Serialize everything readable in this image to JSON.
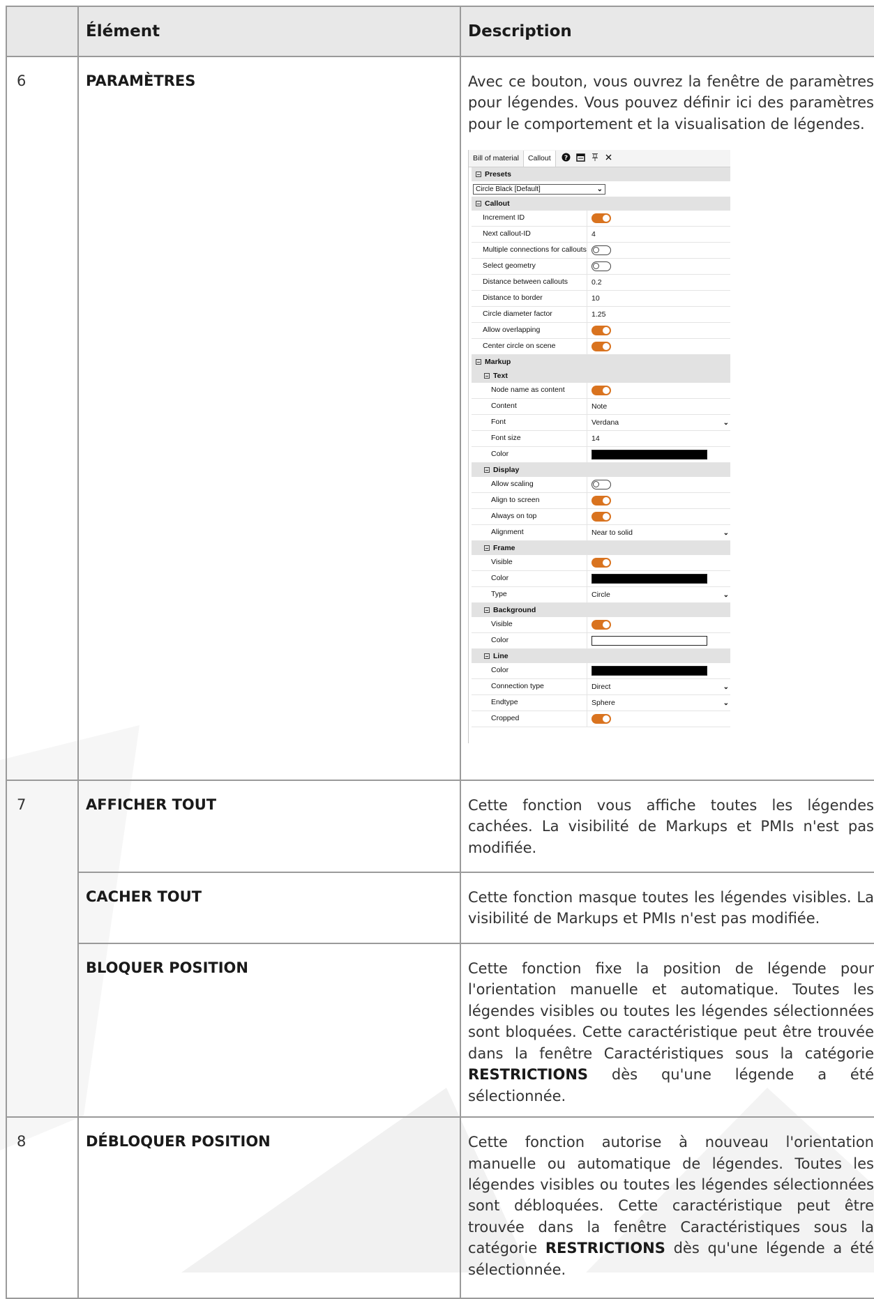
{
  "table": {
    "headers": [
      "",
      "Élément",
      "Description"
    ],
    "rows": [
      {
        "num": "6",
        "name": "PARAMÈTRES",
        "description": "Avec ce bouton, vous ouvrez la fenêtre de paramètres pour légendes. Vous pouvez définir ici des paramètres pour le comportement et la visualisation de légendes."
      },
      {
        "num": "7",
        "name": "AFFICHER TOUT",
        "description": "Cette fonction vous affiche toutes les légendes cachées. La visibilité de Markups et PMIs n'est pas modifiée."
      },
      {
        "num": "",
        "name": "CACHER TOUT",
        "description": "Cette fonction masque toutes les légendes visibles. La visibilité de Markups et PMIs n'est pas modifiée."
      },
      {
        "num": "",
        "name": "BLOQUER POSITION",
        "description_pre": "Cette fonction fixe la position de légende pour l'orientation manuelle et automatique. Toutes les légendes visibles ou toutes les légendes sélectionnées sont bloquées. Cette caractéristique peut être trouvée dans la fenêtre Caractéristiques sous la catégorie",
        "description_bold": "RESTRICTIONS",
        "description_post": "dès qu'une légende a été sélectionnée."
      },
      {
        "num": "8",
        "name": "DÉBLOQUER POSITION",
        "description_pre": "Cette fonction autorise à nouveau l'orientation manuelle ou automatique de légendes. Toutes les légendes visibles ou toutes les légendes sélectionnées sont débloquées. Cette caractéristique peut être trouvée dans la fenêtre Caractéristiques sous la catégorie",
        "description_bold": "RESTRICTIONS",
        "description_post": "dès qu'une légende a été sélectionnée."
      }
    ]
  },
  "panel": {
    "tabs": [
      "Bill of material",
      "Callout"
    ],
    "icons": [
      "help-icon",
      "window-icon",
      "pin-icon",
      "close-icon"
    ],
    "colors": {
      "toggle_on": "#d9731f",
      "group_bg": "#e2e2e2"
    },
    "presets": {
      "label": "Presets",
      "value": "Circle Black [Default]"
    },
    "callout": {
      "label": "Callout",
      "rows": [
        {
          "label": "Increment ID",
          "type": "toggle",
          "on": true
        },
        {
          "label": "Next callout-ID",
          "type": "text",
          "value": "4"
        },
        {
          "label": "Multiple connections for callouts",
          "type": "toggle",
          "on": false
        },
        {
          "label": "Select geometry",
          "type": "toggle",
          "on": false
        },
        {
          "label": "Distance between callouts",
          "type": "text",
          "value": "0.2"
        },
        {
          "label": "Distance to border",
          "type": "text",
          "value": "10"
        },
        {
          "label": "Circle diameter factor",
          "type": "text",
          "value": "1.25"
        },
        {
          "label": "Allow overlapping",
          "type": "toggle",
          "on": true
        },
        {
          "label": "Center circle on scene",
          "type": "toggle",
          "on": true
        }
      ]
    },
    "markup": {
      "label": "Markup",
      "groups": [
        {
          "label": "Text",
          "rows": [
            {
              "label": "Node name as content",
              "type": "toggle",
              "on": true
            },
            {
              "label": "Content",
              "type": "text",
              "value": "Note"
            },
            {
              "label": "Font",
              "type": "select",
              "value": "Verdana"
            },
            {
              "label": "Font size",
              "type": "text",
              "value": "14"
            },
            {
              "label": "Color",
              "type": "color",
              "color": "#000000"
            }
          ]
        },
        {
          "label": "Display",
          "rows": [
            {
              "label": "Allow scaling",
              "type": "toggle",
              "on": false
            },
            {
              "label": "Align to screen",
              "type": "toggle",
              "on": true
            },
            {
              "label": "Always on top",
              "type": "toggle",
              "on": true
            },
            {
              "label": "Alignment",
              "type": "select",
              "value": "Near to solid"
            }
          ]
        },
        {
          "label": "Frame",
          "rows": [
            {
              "label": "Visible",
              "type": "toggle",
              "on": true
            },
            {
              "label": "Color",
              "type": "color",
              "color": "#000000"
            },
            {
              "label": "Type",
              "type": "select",
              "value": "Circle"
            }
          ]
        },
        {
          "label": "Background",
          "rows": [
            {
              "label": "Visible",
              "type": "toggle",
              "on": true
            },
            {
              "label": "Color",
              "type": "color",
              "color": "#ffffff"
            }
          ]
        },
        {
          "label": "Line",
          "rows": [
            {
              "label": "Color",
              "type": "color",
              "color": "#000000"
            },
            {
              "label": "Connection type",
              "type": "select",
              "value": "Direct"
            },
            {
              "label": "Endtype",
              "type": "select",
              "value": "Sphere"
            },
            {
              "label": "Cropped",
              "type": "toggle",
              "on": true
            }
          ]
        }
      ]
    }
  }
}
